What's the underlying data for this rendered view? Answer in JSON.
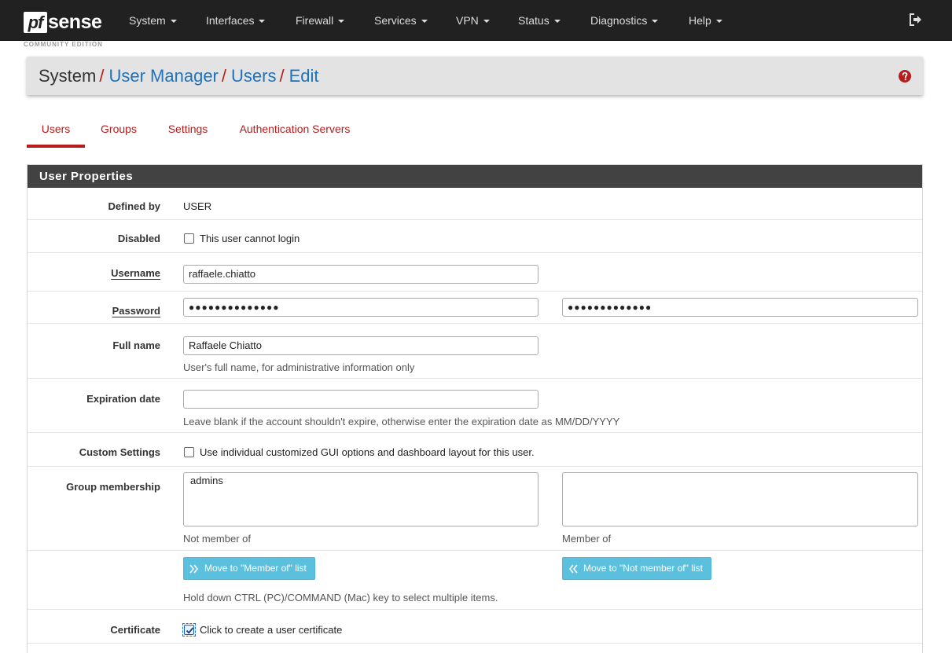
{
  "navbar": {
    "brand_pf": "pf",
    "brand_sense": "sense",
    "brand_sub": "COMMUNITY EDITION",
    "menu": [
      "System",
      "Interfaces",
      "Firewall",
      "Services",
      "VPN",
      "Status",
      "Diagnostics",
      "Help"
    ]
  },
  "breadcrumb": {
    "root": "System",
    "sep": "/",
    "links": [
      "User Manager",
      "Users",
      "Edit"
    ]
  },
  "tabs": [
    {
      "label": "Users",
      "active": true
    },
    {
      "label": "Groups",
      "active": false
    },
    {
      "label": "Settings",
      "active": false
    },
    {
      "label": "Authentication Servers",
      "active": false
    }
  ],
  "panel": {
    "title": "User Properties",
    "defined_by": {
      "label": "Defined by",
      "value": "USER"
    },
    "disabled": {
      "label": "Disabled",
      "checkbox_label": "This user cannot login",
      "checked": false
    },
    "username": {
      "label": "Username",
      "value": "raffaele.chiatto"
    },
    "password": {
      "label": "Password",
      "value": "●●●●●●●●●●●●●●",
      "confirm": "●●●●●●●●●●●●●"
    },
    "full_name": {
      "label": "Full name",
      "value": "Raffaele Chiatto",
      "help": "User's full name, for administrative information only"
    },
    "expiration": {
      "label": "Expiration date",
      "value": "",
      "help": "Leave blank if the account shouldn't expire, otherwise enter the expiration date as MM/DD/YYYY"
    },
    "custom_settings": {
      "label": "Custom Settings",
      "checkbox_label": "Use individual customized GUI options and dashboard layout for this user.",
      "checked": false
    },
    "group_membership": {
      "label": "Group membership",
      "not_member_items": [
        "admins"
      ],
      "member_items": [],
      "not_member_caption": "Not member of",
      "member_caption": "Member of"
    },
    "move_buttons": {
      "to_member": "Move to \"Member of\" list",
      "to_not_member": "Move to \"Not member of\" list",
      "help": "Hold down CTRL (PC)/COMMAND (Mac) key to select multiple items."
    },
    "certificate": {
      "label": "Certificate",
      "checkbox_label": "Click to create a user certificate",
      "checked": true
    }
  },
  "colors": {
    "navbar_bg": "#212121",
    "accent_red": "#b71c1c",
    "link_blue": "#1e73be",
    "panel_heading": "#424242",
    "button_info": "#5bc0de"
  }
}
